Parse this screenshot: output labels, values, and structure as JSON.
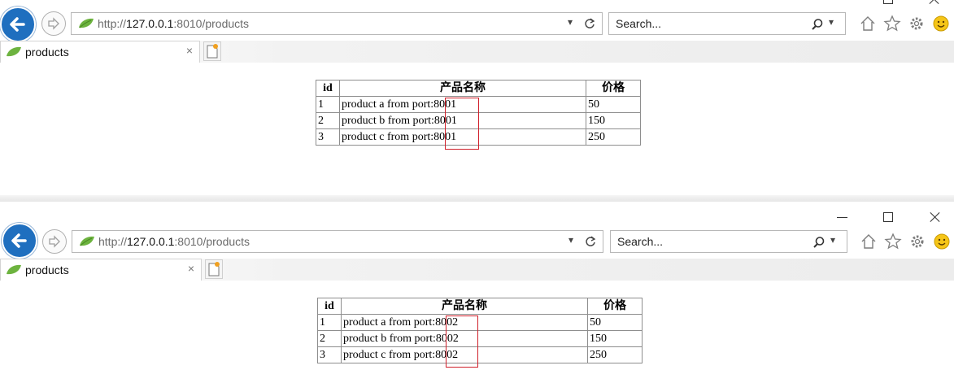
{
  "windows": [
    {
      "address": {
        "prefix": "http://",
        "host": "127.0.0.1",
        "rest": ":8010/products"
      },
      "search_placeholder": "Search...",
      "tab": {
        "title": "products",
        "close": "×"
      },
      "table": {
        "headers": [
          "id",
          "产品名称",
          "价格"
        ],
        "rows": [
          {
            "id": "1",
            "name": "product a from port:",
            "port": "8001",
            "price": "50"
          },
          {
            "id": "2",
            "name": "product b from port:",
            "port": "8001",
            "price": "150"
          },
          {
            "id": "3",
            "name": "product c from port:",
            "port": "8001",
            "price": "250"
          }
        ]
      }
    },
    {
      "address": {
        "prefix": "http://",
        "host": "127.0.0.1",
        "rest": ":8010/products"
      },
      "search_placeholder": "Search...",
      "tab": {
        "title": "products",
        "close": "×"
      },
      "table": {
        "headers": [
          "id",
          "产品名称",
          "价格"
        ],
        "rows": [
          {
            "id": "1",
            "name": "product a from port:",
            "port": "8002",
            "price": "50"
          },
          {
            "id": "2",
            "name": "product b from port:",
            "port": "8002",
            "price": "150"
          },
          {
            "id": "3",
            "name": "product c from port:",
            "port": "8002",
            "price": "250"
          }
        ]
      }
    }
  ],
  "icons": {
    "back": "back-arrow-icon",
    "forward": "forward-arrow-icon",
    "site": "spring-leaf-icon",
    "dropdown": "chevron-down-icon",
    "refresh": "refresh-icon",
    "search": "search-icon",
    "home": "home-icon",
    "favorites": "star-icon",
    "settings": "gear-icon",
    "feedback": "smiley-icon",
    "new_tab": "new-tab-icon",
    "minimize": "minimize-icon",
    "maximize": "maximize-icon",
    "close": "close-icon"
  },
  "colors": {
    "back_button": "#1f6fbf",
    "highlight": "#d0202b",
    "leaf": "#6db33f"
  }
}
